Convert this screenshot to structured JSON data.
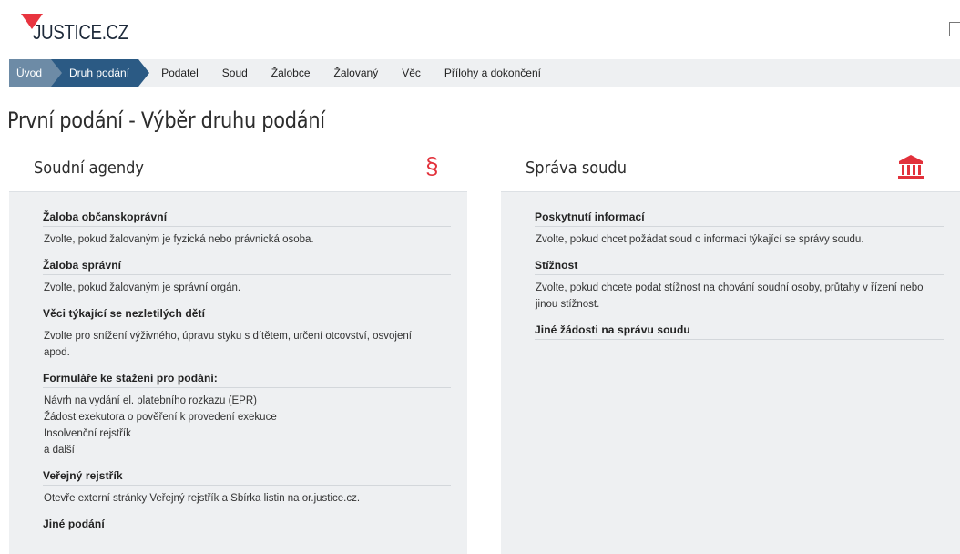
{
  "header": {
    "logo_text": "JUSTICE.CZ"
  },
  "nav": {
    "steps": [
      {
        "label": "Úvod",
        "state": "done"
      },
      {
        "label": "Druh podání",
        "state": "active"
      },
      {
        "label": "Podatel",
        "state": "plain"
      },
      {
        "label": "Soud",
        "state": "plain"
      },
      {
        "label": "Žalobce",
        "state": "plain"
      },
      {
        "label": "Žalovaný",
        "state": "plain"
      },
      {
        "label": "Věc",
        "state": "plain"
      },
      {
        "label": "Přílohy a dokončení",
        "state": "plain"
      }
    ]
  },
  "page": {
    "title": "První podání - Výběr druhu podání"
  },
  "left_panel": {
    "title": "Soudní agendy",
    "icon": "section-icon",
    "icon_glyph": "§",
    "items": [
      {
        "title": "Žaloba občanskoprávní",
        "desc": [
          "Zvolte, pokud žalovaným je fyzická nebo právnická osoba."
        ]
      },
      {
        "title": "Žaloba správní",
        "desc": [
          "Zvolte, pokud žalovaným je správní orgán."
        ]
      },
      {
        "title": "Věci týkající se nezletilých dětí",
        "desc": [
          "Zvolte pro snížení výživného, úpravu styku s dítětem, určení otcovství, osvojení",
          "apod."
        ]
      },
      {
        "title": "Formuláře ke stažení pro podání:",
        "desc": [
          "Návrh na vydání el. platebního rozkazu (EPR)",
          "Žádost exekutora o pověření k provedení exekuce",
          "Insolvenční rejstřík",
          "a další"
        ]
      },
      {
        "title": "Veřejný rejstřík",
        "desc": [
          "Otevře externí stránky Veřejný rejstřík a Sbírka listin na or.justice.cz."
        ]
      },
      {
        "title": "Jiné podání",
        "desc": []
      }
    ]
  },
  "right_panel": {
    "title": "Správa soudu",
    "icon": "courthouse-icon",
    "items": [
      {
        "title": "Poskytnutí informací",
        "desc": [
          "Zvolte, pokud chcet požádat soud o informaci týkající se správy soudu."
        ]
      },
      {
        "title": "Stížnost",
        "desc": [
          "Zvolte, pokud chcete podat stížnost na chování soudní osoby, průtahy v řízení nebo",
          "jinou stížnost."
        ]
      },
      {
        "title": "Jiné žádosti na správu soudu",
        "desc": []
      }
    ]
  },
  "colors": {
    "accent_red": "#e2313b",
    "nav_active": "#2b5a84",
    "nav_done": "#6d8ba6"
  }
}
